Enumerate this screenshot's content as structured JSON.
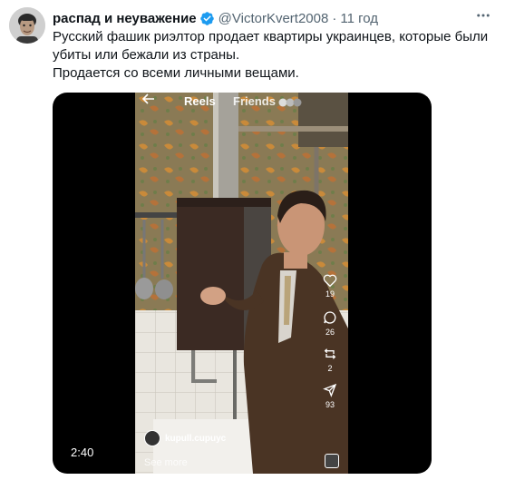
{
  "tweet": {
    "display_name": "распад и неуважение",
    "handle": "@VictorKvert2008",
    "separator": "·",
    "time": "11 год",
    "more_icon": "more-icon",
    "verified_icon": "verified-badge-icon",
    "text_line1": "Русский фашик риэлтор продает квартиры украинцев, которые были убиты или бежали из страны.",
    "text_line2": "Продается со всеми личными вещами."
  },
  "video": {
    "duration": "2:40",
    "reels_label": "Reels",
    "friends_label": "Friends",
    "stats": {
      "likes": "19",
      "comments": "26",
      "reposts": "2",
      "shares": "93"
    },
    "account_name": "kupull.cupuyc",
    "see_more": "See more"
  },
  "colors": {
    "verified": "#1d9bf0",
    "muted": "#536471",
    "text": "#0f1419"
  }
}
